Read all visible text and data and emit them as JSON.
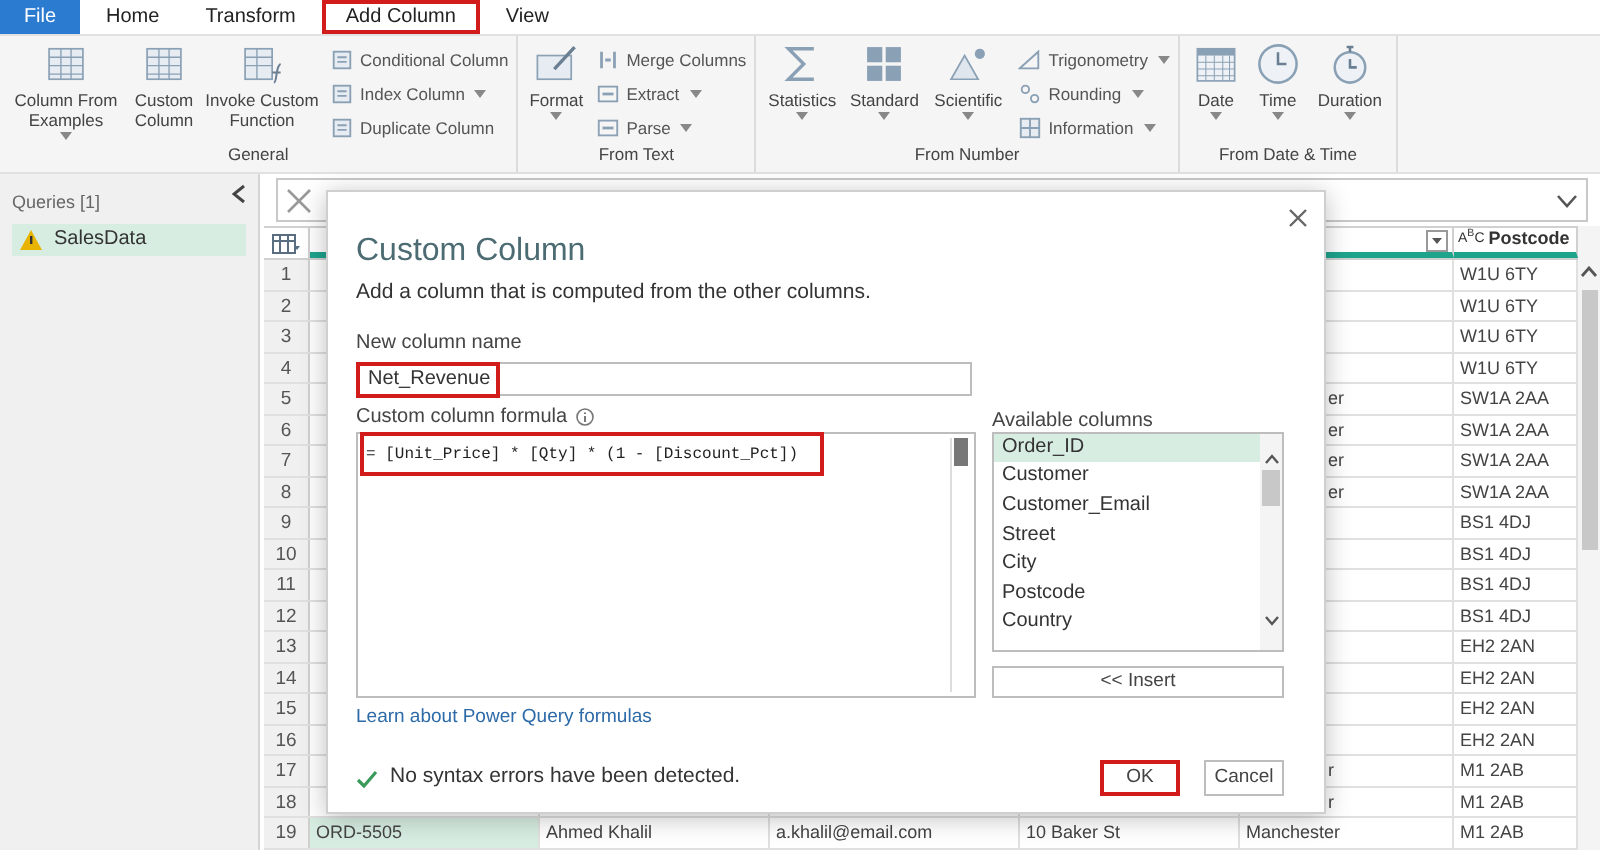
{
  "ribbon_tabs": [
    {
      "label": "File",
      "kind": "file",
      "selected": false
    },
    {
      "label": "Home",
      "kind": "tab",
      "selected": false
    },
    {
      "label": "Transform",
      "kind": "tab",
      "selected": false
    },
    {
      "label": "Add Column",
      "kind": "tab",
      "selected": true
    },
    {
      "label": "View",
      "kind": "tab",
      "selected": false
    }
  ],
  "ribbon_groups": [
    {
      "label": "General",
      "items": [
        {
          "kind": "large",
          "label": "Column From Examples",
          "dropdown": true
        },
        {
          "kind": "large",
          "label": "Custom Column",
          "dropdown": false
        },
        {
          "kind": "large",
          "label": "Invoke Custom Function",
          "dropdown": false
        },
        {
          "kind": "small",
          "label": "Conditional Column",
          "dropdown": false
        },
        {
          "kind": "small",
          "label": "Index Column",
          "dropdown": true
        },
        {
          "kind": "small",
          "label": "Duplicate Column",
          "dropdown": false
        }
      ]
    },
    {
      "label": "From Text",
      "items": [
        {
          "kind": "large",
          "label": "Format",
          "dropdown": true
        },
        {
          "kind": "small",
          "label": "Merge Columns",
          "dropdown": false
        },
        {
          "kind": "small",
          "label": "Extract",
          "dropdown": true
        },
        {
          "kind": "small",
          "label": "Parse",
          "dropdown": true
        }
      ]
    },
    {
      "label": "From Number",
      "items": [
        {
          "kind": "large",
          "label": "Statistics",
          "dropdown": true
        },
        {
          "kind": "large",
          "label": "Standard",
          "dropdown": true
        },
        {
          "kind": "large",
          "label": "Scientific",
          "dropdown": true
        },
        {
          "kind": "small",
          "label": "Trigonometry",
          "dropdown": true
        },
        {
          "kind": "small",
          "label": "Rounding",
          "dropdown": true
        },
        {
          "kind": "small",
          "label": "Information",
          "dropdown": true
        }
      ]
    },
    {
      "label": "From Date & Time",
      "items": [
        {
          "kind": "large",
          "label": "Date",
          "dropdown": true
        },
        {
          "kind": "large",
          "label": "Time",
          "dropdown": true
        },
        {
          "kind": "large",
          "label": "Duration",
          "dropdown": true
        }
      ]
    }
  ],
  "queries": {
    "title": "Queries [1]",
    "items": [
      {
        "label": "SalesData",
        "selected": true,
        "warning": true
      }
    ]
  },
  "table": {
    "columns": [
      {
        "selected": true
      },
      {
        "selected": false
      },
      {
        "selected": false
      },
      {
        "selected": false
      },
      {
        "selected": false,
        "filter": true
      },
      {
        "selected": false,
        "type_icon": "A$^{B}$C",
        "label": "Postcode"
      }
    ],
    "rows": [
      {
        "number": "1",
        "column_6": "W1U 6TY"
      },
      {
        "number": "2",
        "column_6": "W1U 6TY"
      },
      {
        "number": "3",
        "column_6": "W1U 6TY"
      },
      {
        "number": "4",
        "column_6": "W1U 6TY"
      },
      {
        "number": "5",
        "column_5": "er",
        "column_6": "SW1A 2AA"
      },
      {
        "number": "6",
        "column_5": "er",
        "column_6": "SW1A 2AA"
      },
      {
        "number": "7",
        "column_5": "er",
        "column_6": "SW1A 2AA"
      },
      {
        "number": "8",
        "column_5": "er",
        "column_6": "SW1A 2AA"
      },
      {
        "number": "9",
        "column_6": "BS1 4DJ"
      },
      {
        "number": "10",
        "column_6": "BS1 4DJ"
      },
      {
        "number": "11",
        "column_6": "BS1 4DJ"
      },
      {
        "number": "12",
        "column_6": "BS1 4DJ"
      },
      {
        "number": "13",
        "column_6": "EH2 2AN"
      },
      {
        "number": "14",
        "column_6": "EH2 2AN"
      },
      {
        "number": "15",
        "column_6": "EH2 2AN"
      },
      {
        "number": "16",
        "column_6": "EH2 2AN"
      },
      {
        "number": "17",
        "column_5": "r",
        "column_6": "M1 2AB"
      },
      {
        "number": "18",
        "column_5": "r",
        "column_6": "M1 2AB"
      },
      {
        "number": "19",
        "column_1": "ORD-5505",
        "column_2": "Ahmed Khalil",
        "column_3": "a.khalil@email.com",
        "column_4": "10 Baker St",
        "column_5": "Manchester",
        "column_6": "M1 2AB"
      }
    ]
  },
  "dialog": {
    "title": "Custom Column",
    "description": "Add a column that is computed from the other columns.",
    "name_label": "New column name",
    "name_value": "Net_Revenue",
    "name_highlighted": true,
    "formula_label": "Custom column formula",
    "formula": "= [Unit_Price] * [Qty] * (1 - [Discount_Pct])",
    "formula_highlighted": true,
    "available_label": "Available columns",
    "available_columns": [
      {
        "label": "Order_ID",
        "selected": true
      },
      {
        "label": "Customer",
        "selected": false
      },
      {
        "label": "Customer_Email",
        "selected": false
      },
      {
        "label": "Street",
        "selected": false
      },
      {
        "label": "City",
        "selected": false
      },
      {
        "label": "Postcode",
        "selected": false
      },
      {
        "label": "Country",
        "selected": false
      }
    ],
    "insert_button": "<< Insert",
    "learn_link": "Learn about Power Query formulas",
    "status": "No syntax errors have been detected.",
    "buttons": [
      {
        "label": "OK",
        "highlighted": true
      },
      {
        "label": "Cancel",
        "highlighted": false
      }
    ]
  }
}
